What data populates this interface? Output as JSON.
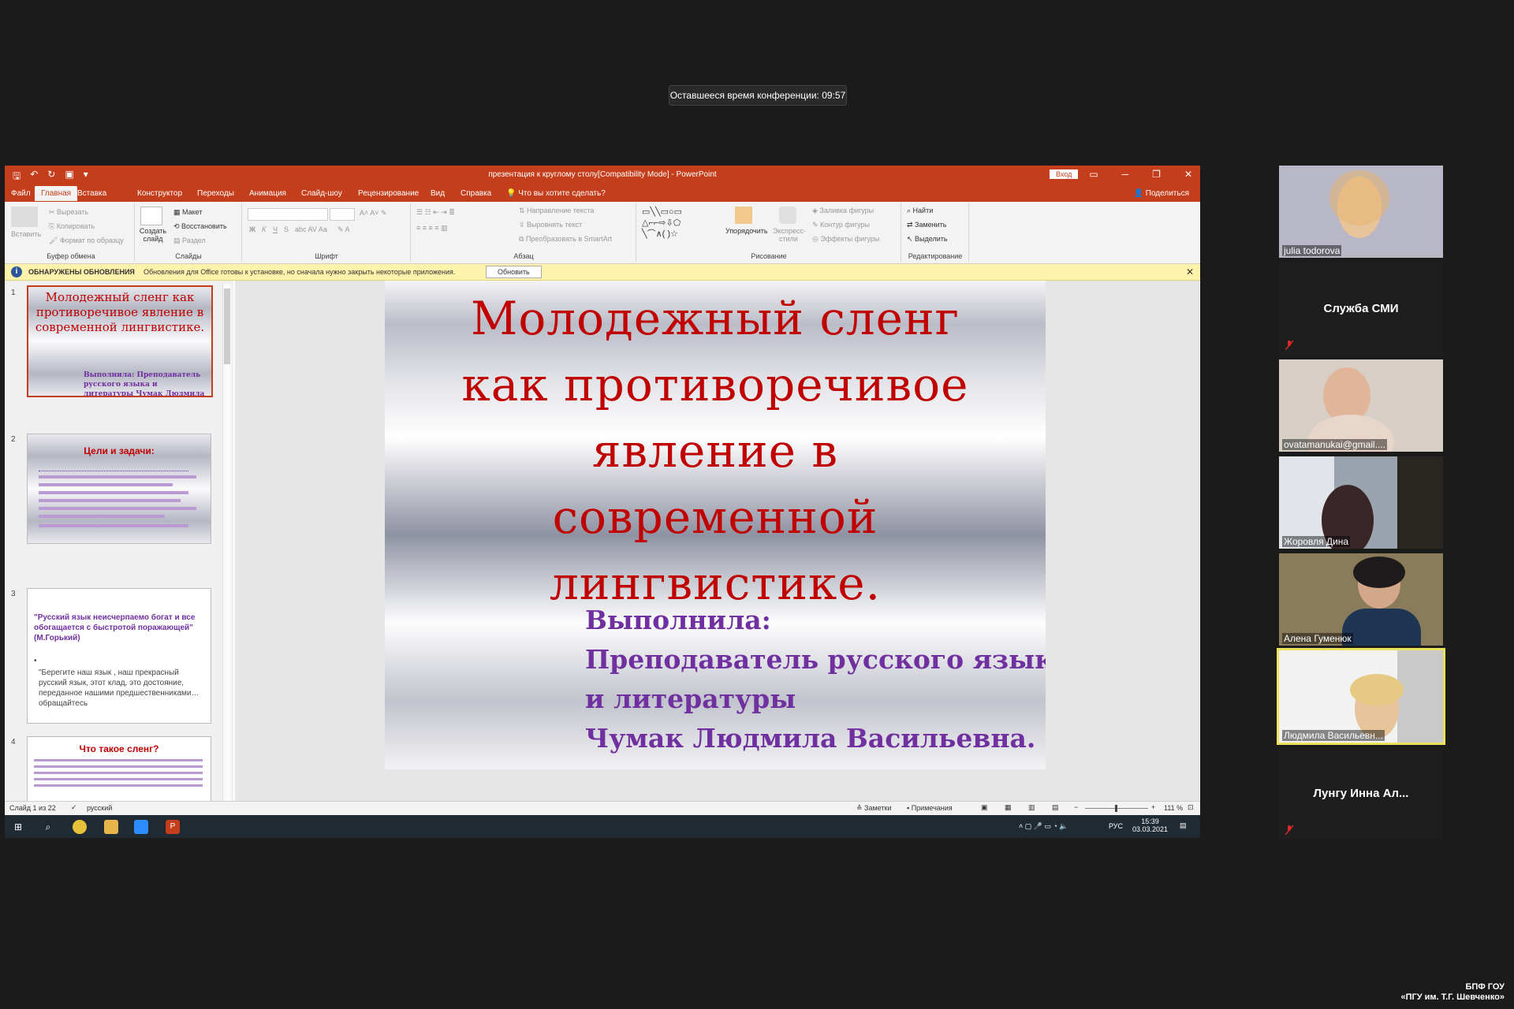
{
  "conference": {
    "remaining_time": "Оставшееся время конференции: 09:57"
  },
  "ppt": {
    "window_title": "презентация к круглому столу[Compatibility Mode] - PowerPoint",
    "login_label": "Вход",
    "tabs": [
      "Файл",
      "Главная",
      "Вставка",
      "Конструктор",
      "Переходы",
      "Анимация",
      "Слайд-шоу",
      "Рецензирование",
      "Вид",
      "Справка"
    ],
    "tell_me": "Что вы хотите сделать?",
    "share": "Поделиться",
    "ribbon": {
      "clipboard": {
        "paste": "Вставить",
        "cut": "Вырезать",
        "copy": "Копировать",
        "format": "Формат по образцу",
        "label": "Буфер обмена"
      },
      "slides": {
        "new": "Создать слайд",
        "layout": "Макет",
        "reset": "Восстановить",
        "section": "Раздел",
        "label": "Слайды"
      },
      "font": {
        "label": "Шрифт"
      },
      "paragraph": {
        "direction": "Направление текста",
        "align": "Выровнять текст",
        "smartart": "Преобразовать в SmartArt",
        "label": "Абзац"
      },
      "drawing": {
        "arrange": "Упорядочить",
        "styles": "Экспресс-стили",
        "fill": "Заливка фигуры",
        "outline": "Контур фигуры",
        "effects": "Эффекты фигуры",
        "label": "Рисование"
      },
      "editing": {
        "find": "Найти",
        "replace": "Заменить",
        "select": "Выделить",
        "label": "Редактирование"
      }
    },
    "infobar": {
      "heading": "ОБНАРУЖЕНЫ ОБНОВЛЕНИЯ",
      "message": "Обновления для Office готовы к установке, но сначала нужно закрыть некоторые приложения.",
      "button": "Обновить"
    },
    "slide": {
      "title_lines": [
        "Молодежный сленг",
        "как противоречивое",
        "явление в",
        "современной",
        "лингвистике."
      ],
      "subtitle_lines": [
        "Выполнила:",
        "Преподаватель русского языка",
        "и литературы",
        "Чумак Людмила Васильевна."
      ]
    },
    "thumbnails": {
      "t1": {
        "num": "1",
        "title": "Молодежный сленг как противоречивое явление в современной лингвистике.",
        "sub": "Выполнила: Преподаватель русского языка и литературы Чумак Людмила Васильевна."
      },
      "t2": {
        "num": "2",
        "title": "Цели и задачи:"
      },
      "t3": {
        "num": "3",
        "quote": "\"Русский язык неисчерпаемо богат и все обогащается с быстротой поражающей\" (М.Горький)",
        "bullet": "•",
        "text": "\"Берегите наш язык , наш прекрасный русский язык, этот клад, это достояние, переданное нашими предшественниками…обращайтесь"
      },
      "t4": {
        "num": "4",
        "title": "Что такое сленг?"
      }
    },
    "status": {
      "slide_count": "Слайд 1 из 22",
      "language": "русский",
      "notes": "Заметки",
      "comments": "Примечания",
      "zoom": "111 %"
    },
    "taskbar": {
      "lang": "РУС",
      "time": "15:39",
      "date": "03.03.2021"
    }
  },
  "participants": [
    {
      "name": "julia todorova"
    },
    {
      "name": "Служба СМИ"
    },
    {
      "name": "ovatamanukai@gmail...."
    },
    {
      "name": "Жоровля Дина"
    },
    {
      "name": "Алена Гуменюк"
    },
    {
      "name": "Людмила Васильевн..."
    },
    {
      "name": "Лунгу Инна Ал..."
    }
  ],
  "footer": {
    "line1": "БПФ ГОУ",
    "line2": "«ПГУ им. Т.Г. Шевченко»"
  },
  "colors": {
    "ppt_accent": "#c43e1c",
    "slide_title": "#c00000",
    "slide_sub": "#7030a0",
    "speaking": "#e9e25a"
  }
}
